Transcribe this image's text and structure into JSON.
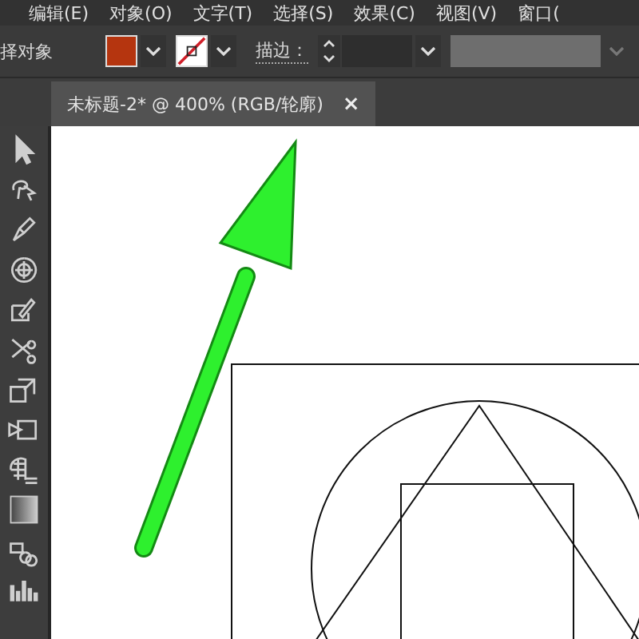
{
  "menu_bar": {
    "items": [
      "编辑(E)",
      "对象(O)",
      "文字(T)",
      "选择(S)",
      "效果(C)",
      "视图(V)",
      "窗口("
    ]
  },
  "control_bar": {
    "selection_label": "择对象",
    "stroke_label": "描边："
  },
  "document_tabs": [
    {
      "title": "未标题-2* @ 400% (RGB/轮廓)",
      "close": "×",
      "selected": true
    }
  ]
}
